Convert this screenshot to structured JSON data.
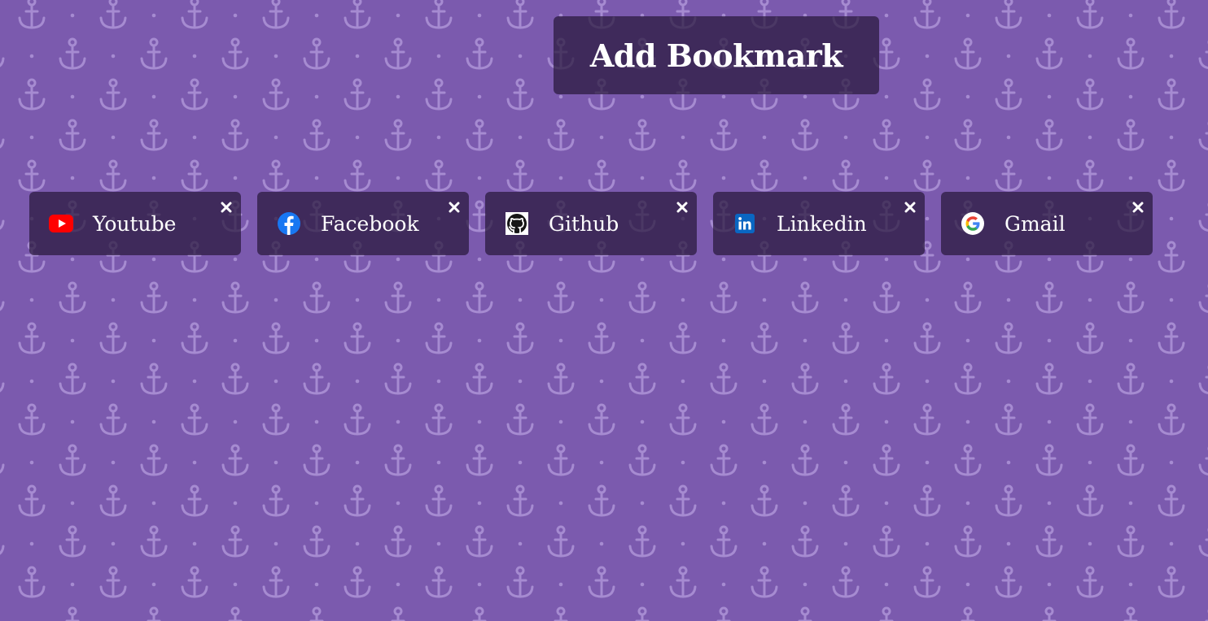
{
  "colors": {
    "background": "#7b5aae",
    "panel": "rgba(40,24,60,0.72)",
    "pattern": "#b49bdc",
    "text": "#ffffff"
  },
  "header": {
    "add_bookmark_label": "Add Bookmark"
  },
  "bookmarks": [
    {
      "label": "Youtube",
      "icon": "youtube-icon"
    },
    {
      "label": "Facebook",
      "icon": "facebook-icon"
    },
    {
      "label": "Github",
      "icon": "github-icon"
    },
    {
      "label": "Linkedin",
      "icon": "linkedin-icon"
    },
    {
      "label": "Gmail",
      "icon": "google-icon"
    }
  ]
}
